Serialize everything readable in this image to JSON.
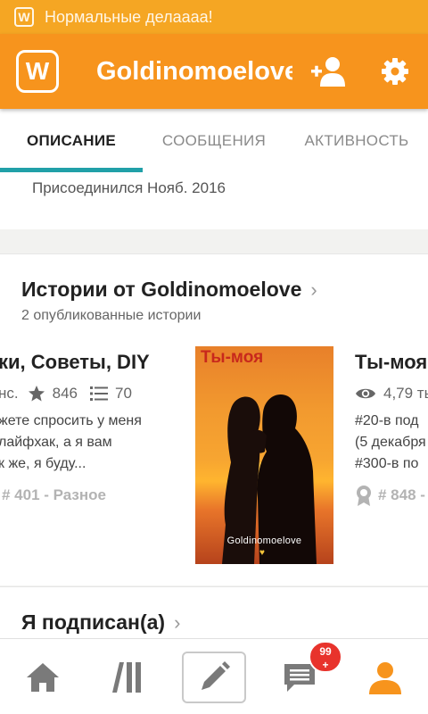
{
  "status_bar": {
    "icon": "wattpad-w-icon",
    "icon_glyph": "W",
    "text": "Нормальные делаааа!"
  },
  "app_bar": {
    "logo_glyph": "W",
    "title": "Goldinomoelove",
    "follow_icon": "add-user-icon",
    "settings_icon": "gear-icon"
  },
  "tabs": [
    {
      "label": "ОПИСАНИЕ",
      "active": true
    },
    {
      "label": "СООБЩЕНИЯ",
      "active": false
    },
    {
      "label": "АКТИВНОСТЬ",
      "active": false
    }
  ],
  "profile": {
    "joined": "Присоединился Нояб. 2016"
  },
  "stories_section": {
    "title": "Истории от Goldinomoelove",
    "subtitle": "2 опубликованные истории",
    "items": [
      {
        "title": "ки, Советы, DIY",
        "reads_suffix": "нс.",
        "votes": "846",
        "parts": "70",
        "desc_lines": [
          "жете спросить у меня",
          "лайфхак, а я вам",
          "к же, я буду..."
        ],
        "rank": "# 401 - Разное"
      },
      {
        "cover_title": "Ты-моя",
        "cover_author": "Goldinomoelove",
        "cover_heart": "♥"
      },
      {
        "title": "Ты-моя",
        "reads": "4,79 ты",
        "desc_lines": [
          "#20-в под",
          "(5 декабря",
          "#300-в по"
        ],
        "rank": "# 848 -"
      }
    ]
  },
  "following_section": {
    "title": "Я подписан(а)"
  },
  "bottom_nav": {
    "items": [
      "home-icon",
      "library-icon",
      "write-icon",
      "inbox-icon",
      "profile-icon"
    ],
    "badge": {
      "count": "99",
      "plus": "+"
    }
  },
  "colors": {
    "status": "#f5a623",
    "app_bar": "#f7941d",
    "tab_indicator": "#21a0a8",
    "badge": "#e8332c",
    "profile_active": "#f7941d",
    "nav_icon": "#7a7a7a"
  }
}
